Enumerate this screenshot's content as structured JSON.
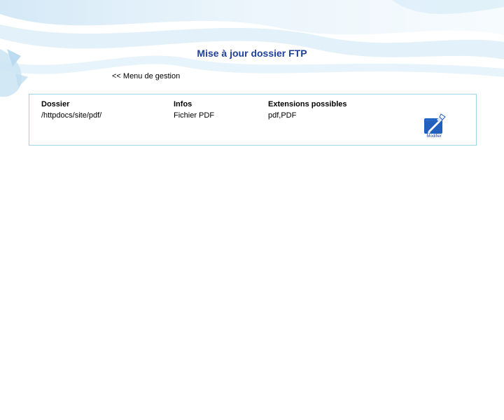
{
  "page": {
    "title": "Mise à jour dossier FTP",
    "back_link": "<< Menu de gestion"
  },
  "table": {
    "headers": {
      "dossier": "Dossier",
      "infos": "Infos",
      "extensions": "Extensions possibles"
    },
    "rows": [
      {
        "dossier": "/httpdocs/site/pdf/",
        "infos": "Fichier PDF",
        "extensions": "pdf,PDF",
        "action_label": "Modifier",
        "action_icon": "edit-icon"
      }
    ]
  },
  "colors": {
    "title": "#1f3f9c",
    "panel_border": "#9fd7ea",
    "icon_blue": "#1f5fbf"
  }
}
